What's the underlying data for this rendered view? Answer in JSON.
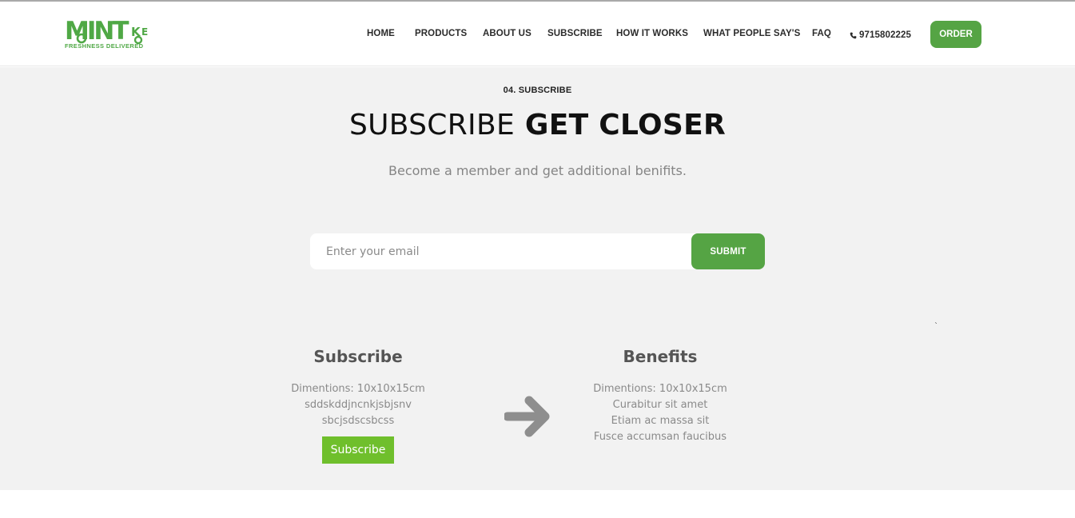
{
  "brand": {
    "name": "MINT",
    "tag": "KE",
    "tagline": "FRESHNESS DELIVERED",
    "color": "#4fa845"
  },
  "nav": {
    "items": [
      {
        "label": "HOME"
      },
      {
        "label": "PRODUCTS"
      },
      {
        "label": "ABOUT US"
      },
      {
        "label": "SUBSCRIBE"
      },
      {
        "label": "HOW IT WORKS"
      },
      {
        "label": "WHAT PEOPLE SAY'S"
      },
      {
        "label": "FAQ"
      }
    ],
    "phone": "9715802225",
    "phone_icon": "phone-icon",
    "order_label": "ORDER"
  },
  "section": {
    "eyebrow": "04. SUBSCRIBE",
    "headline_light": "SUBSCRIBE",
    "headline_bold": "GET CLOSER",
    "lead": "Become a member and get additional benifits."
  },
  "form": {
    "placeholder": "Enter your email",
    "value": "",
    "submit_label": "SUBMIT"
  },
  "subscribe_col": {
    "title": "Subscribe",
    "lines": [
      "Dimentions: 10x10x15cm",
      "sddskddjncnkjsbjsnv",
      "sbcjsdscsbcss"
    ],
    "button_label": "Subscribe"
  },
  "benefits_col": {
    "title": "Benefits",
    "lines": [
      "Dimentions: 10x10x15cm",
      "Curabitur sit amet",
      "Etiam ac massa sit",
      "Fusce accumsan faucibus"
    ]
  },
  "arrow_icon": "arrow-right-icon",
  "colors": {
    "accent": "#55a444",
    "subscribe_button": "#6fbf2c",
    "section_bg": "#f2f2f2"
  }
}
